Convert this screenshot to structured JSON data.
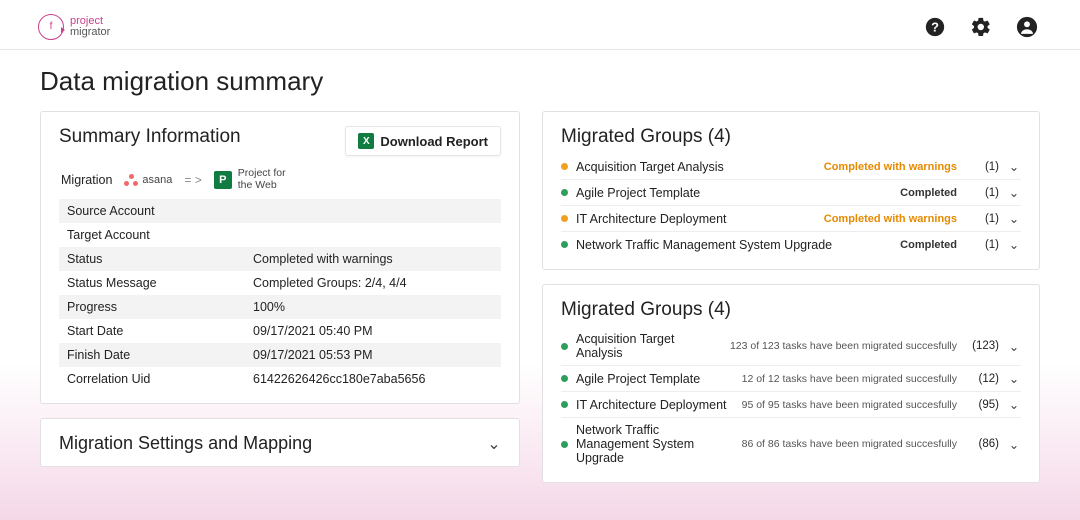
{
  "brand": {
    "top": "project",
    "bot": "migrator"
  },
  "page_title": "Data migration summary",
  "summary": {
    "title": "Summary Information",
    "download_label": "Download Report",
    "migration_label": "Migration",
    "source_name": "asana",
    "target_name_line1": "Project for",
    "target_name_line2": "the Web",
    "target_badge": "P",
    "arrow": "= >",
    "rows": [
      {
        "k": "Source Account",
        "v": ""
      },
      {
        "k": "Target Account",
        "v": ""
      },
      {
        "k": "Status",
        "v": "Completed with warnings"
      },
      {
        "k": "Status Message",
        "v": "Completed Groups: 2/4, 4/4"
      },
      {
        "k": "Progress",
        "v": "100%"
      },
      {
        "k": "Start Date",
        "v": "09/17/2021 05:40 PM"
      },
      {
        "k": "Finish Date",
        "v": "09/17/2021 05:53 PM"
      },
      {
        "k": "Correlation Uid",
        "v": "61422626426cc180e7aba5656"
      }
    ]
  },
  "settings_title": "Migration Settings and Mapping",
  "groups1": {
    "title": "Migrated Groups (4)",
    "items": [
      {
        "dot": "orange",
        "name": "Acquisition Target Analysis",
        "status": "Completed with warnings",
        "status_kind": "warn",
        "count": "(1)"
      },
      {
        "dot": "green",
        "name": "Agile Project Template",
        "status": "Completed",
        "status_kind": "ok",
        "count": "(1)"
      },
      {
        "dot": "orange",
        "name": "IT Architecture Deployment",
        "status": "Completed with warnings",
        "status_kind": "warn",
        "count": "(1)"
      },
      {
        "dot": "green",
        "name": "Network Traffic Management System Upgrade",
        "status": "Completed",
        "status_kind": "ok",
        "count": "(1)"
      }
    ]
  },
  "groups2": {
    "title": "Migrated Groups (4)",
    "items": [
      {
        "dot": "green",
        "name": "Acquisition Target Analysis",
        "msg": "123 of 123 tasks have been migrated succesfully",
        "count": "(123)"
      },
      {
        "dot": "green",
        "name": "Agile Project Template",
        "msg": "12 of 12 tasks have been migrated succesfully",
        "count": "(12)"
      },
      {
        "dot": "green",
        "name": "IT Architecture Deployment",
        "msg": "95 of 95 tasks have been migrated succesfully",
        "count": "(95)"
      },
      {
        "dot": "green",
        "name": "Network Traffic Management System Upgrade",
        "msg": "86 of 86 tasks have been migrated succesfully",
        "count": "(86)"
      }
    ]
  }
}
